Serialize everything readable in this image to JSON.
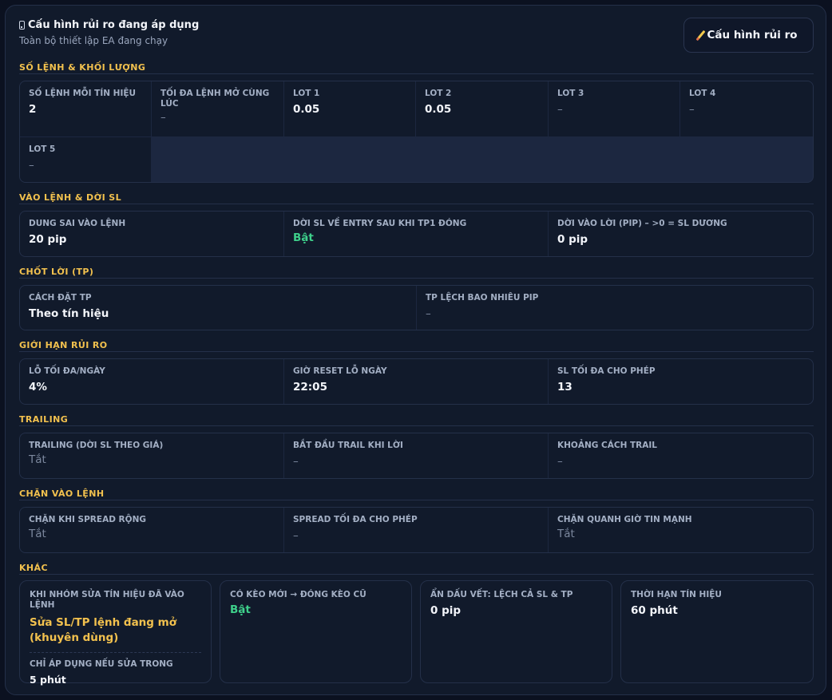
{
  "header": {
    "title": "Cấu hình rủi ro đang áp dụng",
    "subtitle": "Toàn bộ thiết lập EA đang chạy",
    "button_label": "Cấu hình rủi ro"
  },
  "sections": {
    "lots": {
      "title": "SỐ LỆNH & KHỐI LƯỢNG",
      "items": [
        {
          "label": "SỐ LỆNH MỖI TÍN HIỆU",
          "value": "2"
        },
        {
          "label": "TỐI ĐA LỆNH MỞ CÙNG LÚC",
          "value": "–"
        },
        {
          "label": "LOT 1",
          "value": "0.05"
        },
        {
          "label": "LOT 2",
          "value": "0.05"
        },
        {
          "label": "LOT 3",
          "value": "–"
        },
        {
          "label": "LOT 4",
          "value": "–"
        },
        {
          "label": "LOT 5",
          "value": "–"
        }
      ]
    },
    "entry": {
      "title": "VÀO LỆNH & DỜI SL",
      "items": [
        {
          "label": "DUNG SAI VÀO LỆNH",
          "value": "20 pip"
        },
        {
          "label": "DỜI SL VỀ ENTRY SAU KHI TP1 ĐÓNG",
          "value": "Bật"
        },
        {
          "label": "DỜI VÀO LỜI (PIP) – >0 = SL DƯƠNG",
          "value": "0 pip"
        }
      ]
    },
    "tp": {
      "title": "CHỐT LỜI (TP)",
      "items": [
        {
          "label": "CÁCH ĐẶT TP",
          "value": "Theo tín hiệu"
        },
        {
          "label": "TP LỆCH BAO NHIÊU PIP",
          "value": "–"
        }
      ]
    },
    "risk": {
      "title": "GIỚI HẠN RỦI RO",
      "items": [
        {
          "label": "LỖ TỐI ĐA/NGÀY",
          "value": "4%"
        },
        {
          "label": "GIỜ RESET LỖ NGÀY",
          "value": "22:05"
        },
        {
          "label": "SL TỐI ĐA CHO PHÉP",
          "value": "13"
        }
      ]
    },
    "trailing": {
      "title": "TRAILING",
      "items": [
        {
          "label": "TRAILING (DỜI SL THEO GIÁ)",
          "value": "Tắt"
        },
        {
          "label": "BẮT ĐẦU TRAIL KHI LỜI",
          "value": "–"
        },
        {
          "label": "KHOẢNG CÁCH TRAIL",
          "value": "–"
        }
      ]
    },
    "block": {
      "title": "CHẶN VÀO LỆNH",
      "items": [
        {
          "label": "CHẶN KHI SPREAD RỘNG",
          "value": "Tắt"
        },
        {
          "label": "SPREAD TỐI ĐA CHO PHÉP",
          "value": "–"
        },
        {
          "label": "CHẶN QUANH GIỜ TIN MẠNH",
          "value": "Tắt"
        }
      ]
    },
    "other": {
      "title": "KHÁC",
      "items": [
        {
          "label": "KHI NHÓM SỬA TÍN HIỆU ĐÃ VÀO LỆNH",
          "value": "Sửa SL/TP lệnh đang mở (khuyên dùng)",
          "sub_label": "CHỈ ÁP DỤNG NẾU SỬA TRONG",
          "sub_value": "5 phút"
        },
        {
          "label": "CÓ KÈO MỚI → ĐÓNG KÈO CŨ",
          "value": "Bật"
        },
        {
          "label": "ẨN DẤU VẾT: LỆCH CẢ SL & TP",
          "value": "0 pip"
        },
        {
          "label": "THỜI HẠN TÍN HIỆU",
          "value": "60 phút"
        }
      ]
    }
  }
}
